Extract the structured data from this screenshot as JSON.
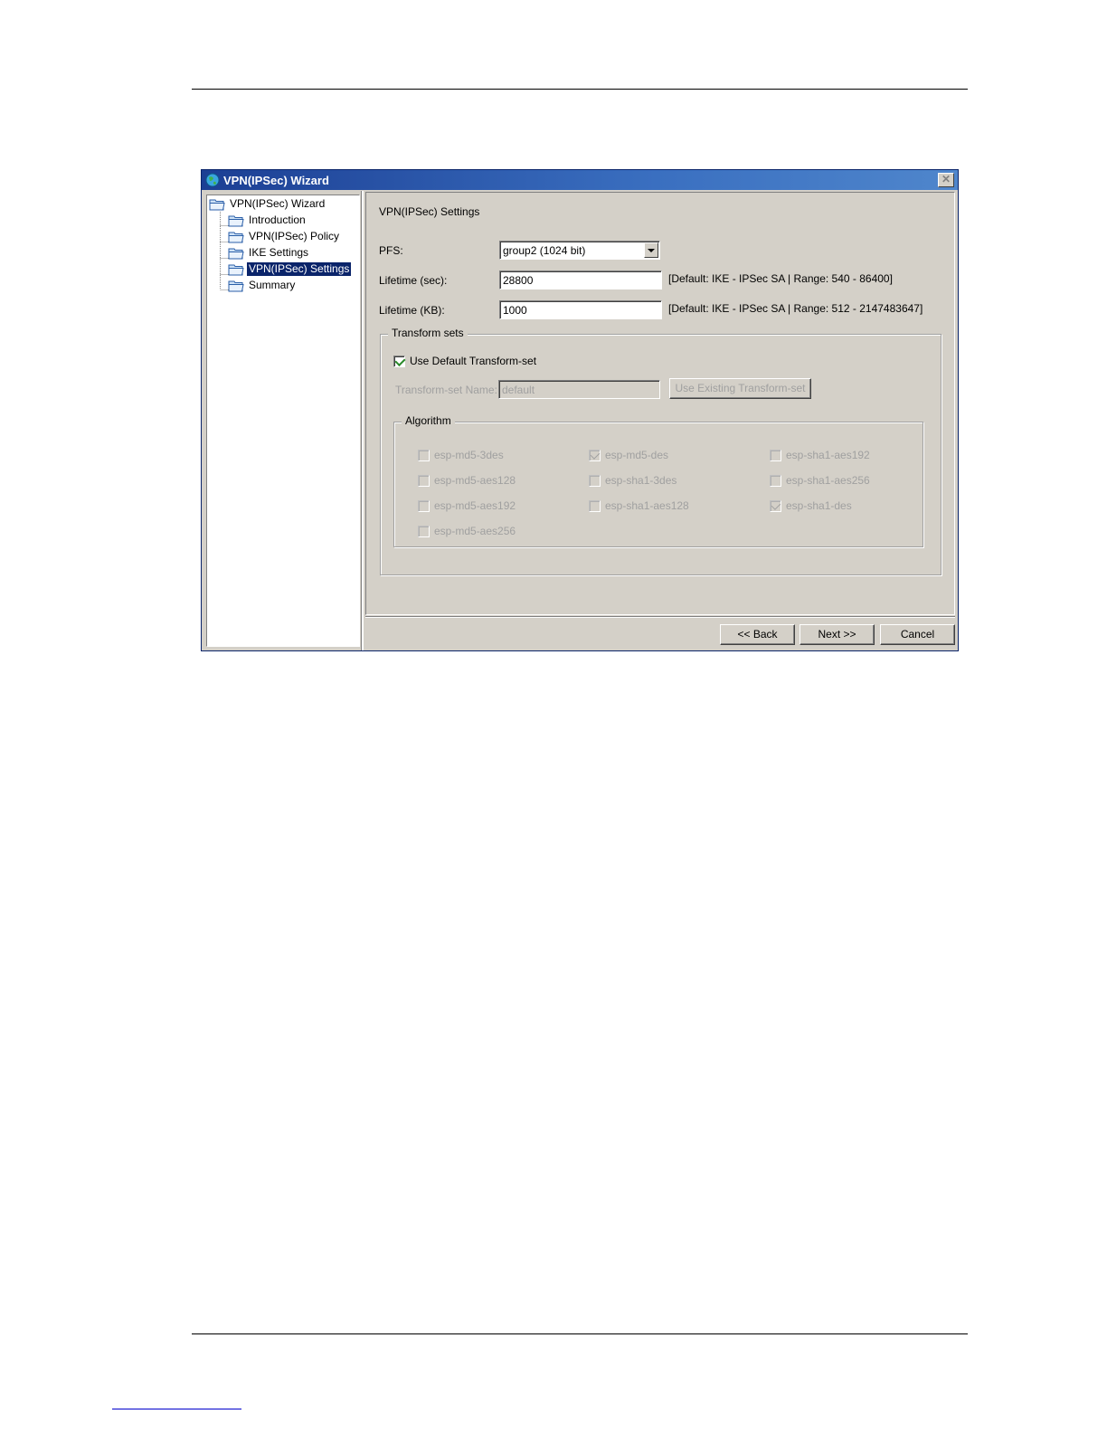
{
  "window": {
    "title": "VPN(IPSec) Wizard",
    "close_glyph": "✕"
  },
  "tree": {
    "root": "VPN(IPSec) Wizard",
    "items": [
      {
        "label": "Introduction",
        "selected": false
      },
      {
        "label": "VPN(IPSec) Policy",
        "selected": false
      },
      {
        "label": "IKE Settings",
        "selected": false
      },
      {
        "label": "VPN(IPSec) Settings",
        "selected": true
      },
      {
        "label": "Summary",
        "selected": false
      }
    ]
  },
  "settings": {
    "heading": "VPN(IPSec) Settings",
    "pfs_label": "PFS:",
    "pfs_value": "group2 (1024 bit)",
    "lifetime_sec_label": "Lifetime (sec):",
    "lifetime_sec_value": "28800",
    "lifetime_sec_hint": "[Default: IKE - IPSec SA | Range: 540 - 86400]",
    "lifetime_kb_label": "Lifetime (KB):",
    "lifetime_kb_value": "1000",
    "lifetime_kb_hint": "[Default: IKE - IPSec SA | Range: 512 - 2147483647]"
  },
  "transform_sets": {
    "title": "Transform sets",
    "use_default_label": "Use Default Transform-set",
    "use_default_checked": true,
    "name_label": "Transform-set Name:",
    "name_value": "default",
    "use_existing_label": "Use Existing Transform-set"
  },
  "algorithm": {
    "title": "Algorithm",
    "options": [
      {
        "label": "esp-md5-3des",
        "checked": false
      },
      {
        "label": "esp-md5-des",
        "checked": true
      },
      {
        "label": "esp-sha1-aes192",
        "checked": false
      },
      {
        "label": "esp-md5-aes128",
        "checked": false
      },
      {
        "label": "esp-sha1-3des",
        "checked": false
      },
      {
        "label": "esp-sha1-aes256",
        "checked": false
      },
      {
        "label": "esp-md5-aes192",
        "checked": false
      },
      {
        "label": "esp-sha1-aes128",
        "checked": false
      },
      {
        "label": "esp-sha1-des",
        "checked": true
      },
      {
        "label": "esp-md5-aes256",
        "checked": false
      }
    ]
  },
  "buttons": {
    "back": "<< Back",
    "next": "Next >>",
    "cancel": "Cancel"
  },
  "colors": {
    "title_bar": "#1c3f94",
    "window_face": "#d4d0c8",
    "selection": "#0a246a",
    "check_enabled": "#2a8a2a"
  }
}
